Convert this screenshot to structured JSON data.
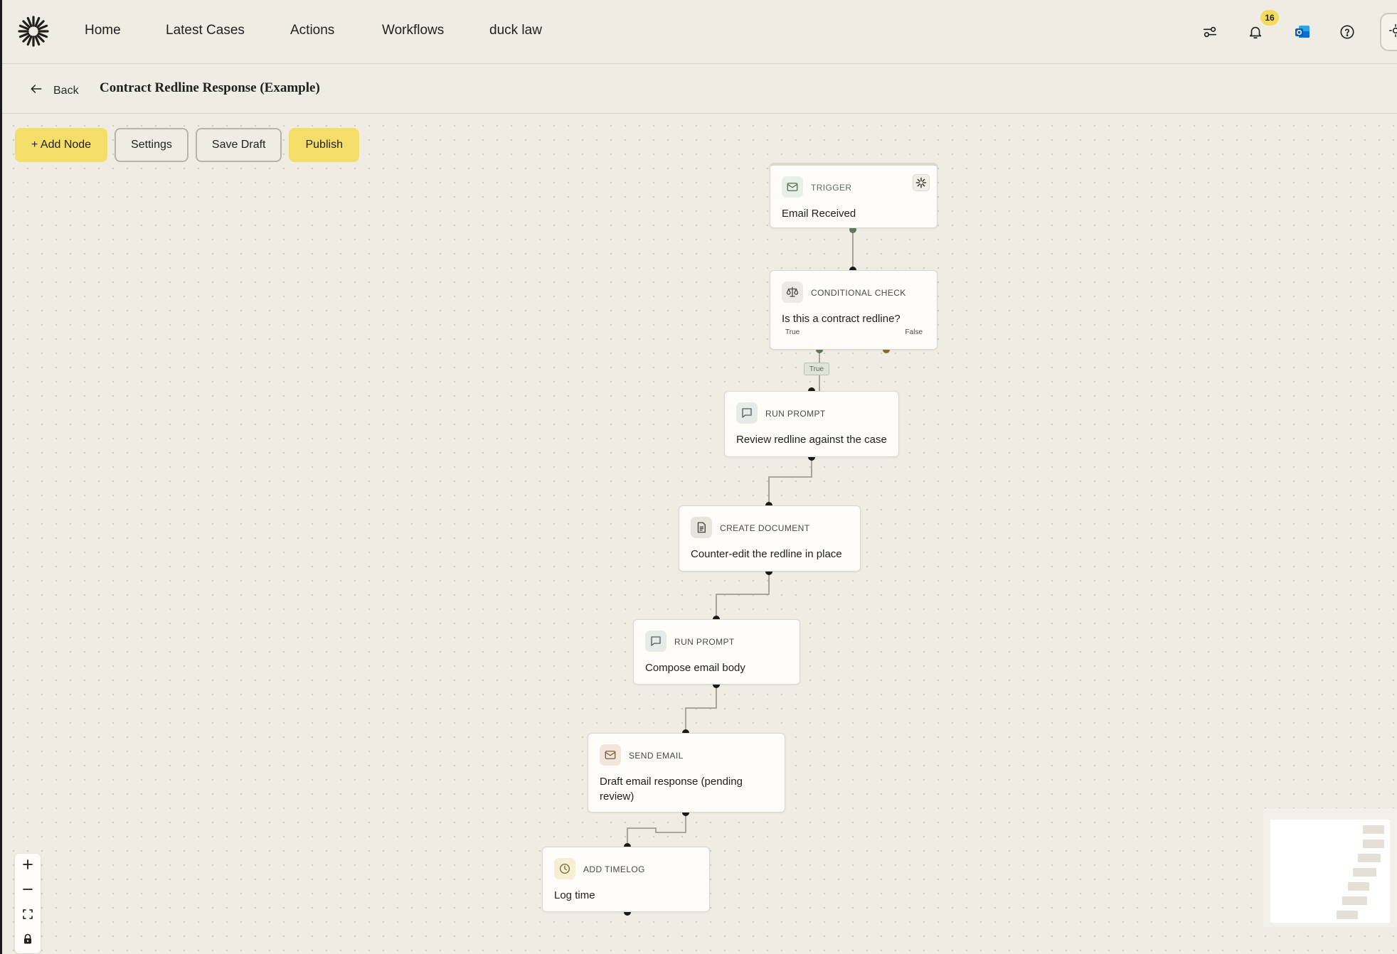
{
  "nav": {
    "items": [
      "Home",
      "Latest Cases",
      "Actions",
      "Workflows",
      "duck law"
    ],
    "notifications_count": "16"
  },
  "subheader": {
    "back_label": "Back",
    "title": "Contract Redline Response (Example)"
  },
  "toolbar": {
    "add_node": "+ Add Node",
    "settings": "Settings",
    "save_draft": "Save Draft",
    "publish": "Publish"
  },
  "nodes": [
    {
      "type": "TRIGGER",
      "label": "Email Received",
      "icon": "mail-icon"
    },
    {
      "type": "CONDITIONAL CHECK",
      "label": "Is this a contract redline?",
      "icon": "scale-icon",
      "true_label": "True",
      "false_label": "False"
    },
    {
      "type": "RUN PROMPT",
      "label": "Review redline against the case",
      "icon": "chat-icon"
    },
    {
      "type": "CREATE DOCUMENT",
      "label": "Counter-edit the redline in place",
      "icon": "document-icon"
    },
    {
      "type": "RUN PROMPT",
      "label": "Compose email body",
      "icon": "chat-icon"
    },
    {
      "type": "SEND EMAIL",
      "label": "Draft email response (pending review)",
      "icon": "mail-icon"
    },
    {
      "type": "ADD TIMELOG",
      "label": "Log time",
      "icon": "clock-icon"
    }
  ],
  "edge_tag": "True",
  "colors": {
    "accent": "#f5dd6a",
    "background": "#efece4",
    "true_handle": "#5a7a5a",
    "false_handle": "#8a6d2e"
  }
}
